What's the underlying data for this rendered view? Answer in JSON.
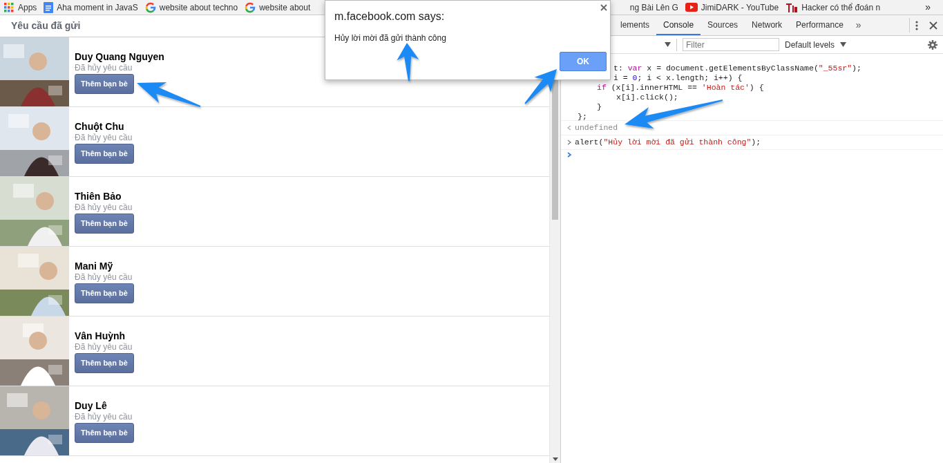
{
  "bookmarks": [
    {
      "kind": "apps",
      "label": "Apps"
    },
    {
      "kind": "doc",
      "label": "Aha moment in JavaS"
    },
    {
      "kind": "google",
      "label": "website about techno"
    },
    {
      "kind": "google",
      "label": "website about"
    },
    {
      "kind": "cut",
      "label": "ng Bài Lên G"
    },
    {
      "kind": "youtube",
      "label": "JimiDARK - YouTube"
    },
    {
      "kind": "logo",
      "label": "Hacker có thể đoán n"
    }
  ],
  "bookmarks_more": "»",
  "page": {
    "title": "Yêu cầu đã gửi",
    "requests": [
      {
        "name": "Duy Quang Nguyen",
        "status": "Đã hủy yêu cầu",
        "button": "Thêm bạn bè"
      },
      {
        "name": "Chuột Chu",
        "status": "Đã hủy yêu cầu",
        "button": "Thêm bạn bè"
      },
      {
        "name": "Thiên Bảo",
        "status": "Đã hủy yêu cầu",
        "button": "Thêm bạn bè"
      },
      {
        "name": "Mani Mỹ",
        "status": "Đã hủy yêu cầu",
        "button": "Thêm bạn bè"
      },
      {
        "name": "Vân Huỳnh",
        "status": "Đã hủy yêu cầu",
        "button": "Thêm bạn bè"
      },
      {
        "name": "Duy Lê",
        "status": "Đã hủy yêu cầu",
        "button": "Thêm bạn bè"
      }
    ]
  },
  "devtools": {
    "tabs": [
      {
        "label": "lements",
        "selected": false
      },
      {
        "label": "Console",
        "selected": true
      },
      {
        "label": "Sources",
        "selected": false
      },
      {
        "label": "Network",
        "selected": false
      },
      {
        "label": "Performance",
        "selected": false
      }
    ],
    "tabs_more": "»",
    "filter": {
      "placeholder": "Filter"
    },
    "levels": "Default levels",
    "console": [
      {
        "kind": "code",
        "cut": true,
        "tokens": [
          {
            "kind": "plain",
            "text": "t: "
          },
          {
            "kind": "keyword",
            "text": "var"
          },
          {
            "kind": "plain",
            "text": " x = document.getElementsByClassName("
          },
          {
            "kind": "string",
            "text": "\"_55sr\""
          },
          {
            "kind": "plain",
            "text": ");"
          }
        ]
      },
      {
        "kind": "code",
        "cut": true,
        "tokens": [
          {
            "kind": "plain",
            "text": "i = "
          },
          {
            "kind": "number",
            "text": "0"
          },
          {
            "kind": "plain",
            "text": "; i < x.length; i++) {"
          }
        ],
        "children": [
          {
            "tokens": [
              {
                "kind": "keyword",
                "text": "if"
              },
              {
                "kind": "plain",
                "text": " (x[i].innerHTML == "
              },
              {
                "kind": "string",
                "text": "'Hoàn tác'"
              },
              {
                "kind": "plain",
                "text": ") {"
              }
            ],
            "children": [
              {
                "tokens": [
                  {
                    "kind": "plain",
                    "text": "x[i].click();"
                  }
                ]
              }
            ]
          },
          {
            "tokens": [
              {
                "kind": "plain",
                "text": "}"
              }
            ]
          }
        ]
      },
      {
        "kind": "code",
        "tokens": [
          {
            "kind": "plain",
            "text": "};"
          }
        ]
      },
      {
        "kind": "result",
        "text": "undefined"
      },
      {
        "kind": "input",
        "tokens": [
          {
            "kind": "plain",
            "text": "alert("
          },
          {
            "kind": "string",
            "text": "\"Hủy lời mời đã gửi thành công\""
          },
          {
            "kind": "plain",
            "text": ");"
          }
        ]
      },
      {
        "kind": "prompt"
      }
    ]
  },
  "dialog": {
    "title": "m.facebook.com says:",
    "message": "Hủy lời mời đã gửi thành công",
    "button": "OK"
  }
}
